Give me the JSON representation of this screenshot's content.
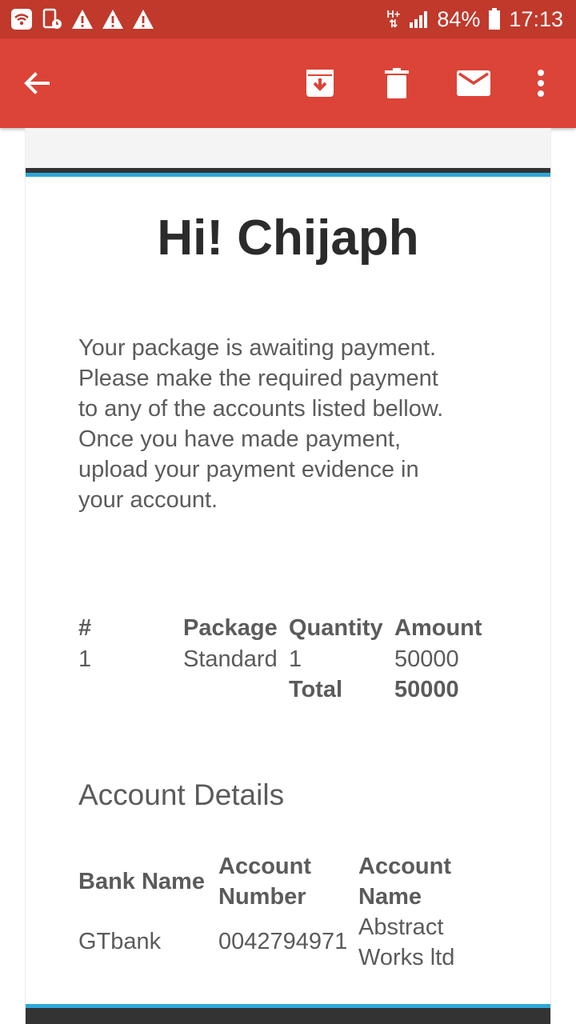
{
  "status_bar": {
    "network": "H+",
    "battery": "84%",
    "time": "17:13"
  },
  "app_bar": {
    "back_icon": "arrow-back-icon",
    "archive_icon": "archive-icon",
    "delete_icon": "trash-icon",
    "mark_unread_icon": "mail-icon",
    "overflow_icon": "more-vert-icon"
  },
  "colors": {
    "status_bar": "#c0392b",
    "app_bar": "#db4437",
    "accent_blue": "#2ea8d8",
    "dark_stripe": "#333333"
  },
  "email": {
    "greeting": "Hi! Chijaph",
    "body_lines": [
      "Your package is awaiting payment.",
      "Please make the required payment",
      "to any of the accounts listed bellow.",
      "Once you have made payment,",
      "upload your payment evidence in",
      "your account."
    ],
    "order": {
      "headers": [
        "#",
        "Package",
        "Quantity",
        "Amount"
      ],
      "row": [
        "1",
        "Standard",
        "1",
        "50000"
      ],
      "total_label": "Total",
      "total_value": "50000"
    },
    "account_details": {
      "title": "Account Details",
      "headers": {
        "bank_name": "Bank Name",
        "account_number_1": "Account",
        "account_number_2": "Number",
        "account_name_1": "Account",
        "account_name_2": "Name"
      },
      "row": {
        "bank_name": "GTbank",
        "account_number": "0042794971",
        "account_name_1": "Abstract",
        "account_name_2": "Works ltd"
      }
    }
  }
}
